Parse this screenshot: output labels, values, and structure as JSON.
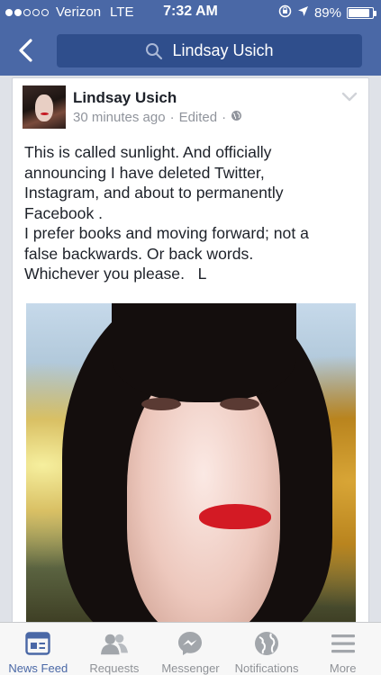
{
  "status_bar": {
    "carrier": "Verizon",
    "network": "LTE",
    "time": "7:32 AM",
    "battery_text": "89%",
    "battery_level": 0.89,
    "signal_bars_filled": 2,
    "signal_bars_total": 5
  },
  "nav": {
    "search_text": "Lindsay Usich"
  },
  "post": {
    "author": "Lindsay Usich",
    "time_ago": "30 minutes ago",
    "separator": "·",
    "edited": "Edited",
    "lines": [
      "This is called sunlight. And officially",
      "announcing I have deleted Twitter,",
      "Instagram, and about to permanently",
      "Facebook .",
      "I prefer books and moving forward; not a",
      "false backwards. Or back words.",
      "Whichever you please.   L"
    ]
  },
  "tabs": [
    {
      "label": "News Feed",
      "icon": "news-feed-icon",
      "active": true
    },
    {
      "label": "Requests",
      "icon": "friend-requests-icon",
      "active": false
    },
    {
      "label": "Messenger",
      "icon": "messenger-icon",
      "active": false
    },
    {
      "label": "Notifications",
      "icon": "globe-icon",
      "active": false
    },
    {
      "label": "More",
      "icon": "menu-icon",
      "active": false
    }
  ],
  "colors": {
    "brand_blue": "#4a68a6",
    "search_bg": "#2f4e8c",
    "inactive_tab": "#8f9297"
  }
}
